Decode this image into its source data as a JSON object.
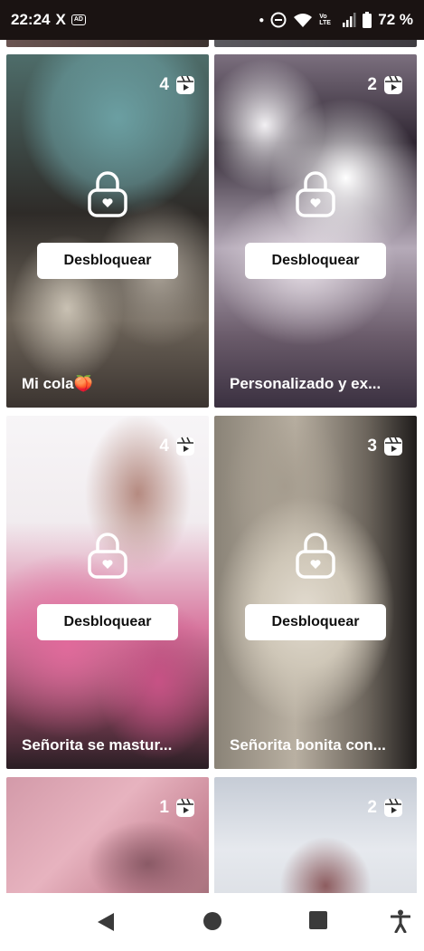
{
  "status_bar": {
    "time": "22:24",
    "x_icon": "X",
    "ad_icon": "AD",
    "network_label": "Vo LTE",
    "battery_percent": "72 %"
  },
  "cards": [
    {
      "count": "4",
      "unlock_label": "Desbloquear",
      "caption": "Mi cola",
      "caption_emoji": "🍑",
      "icon": "reels-icon",
      "palette": [
        "#5a8a8e",
        "#3a3530",
        "#b7b1a6"
      ]
    },
    {
      "count": "2",
      "unlock_label": "Desbloquear",
      "caption": "Personalizado y ex...",
      "caption_emoji": "",
      "icon": "reels-icon",
      "palette": [
        "#ffffff",
        "#3a2f3d",
        "#cfc6d1"
      ]
    },
    {
      "count": "4",
      "unlock_label": "Desbloquear",
      "caption": "Señorita se mastur...",
      "caption_emoji": "",
      "icon": "reels-icon",
      "palette": [
        "#f4f1f3",
        "#d65a8f",
        "#8a5a4e"
      ]
    },
    {
      "count": "3",
      "unlock_label": "Desbloquear",
      "caption": "Señorita bonita con...",
      "caption_emoji": "",
      "icon": "reels-icon",
      "palette": [
        "#9b9488",
        "#d9d2c6",
        "#3a3532"
      ]
    },
    {
      "count": "1",
      "unlock_label": "",
      "caption": "",
      "caption_emoji": "",
      "icon": "reels-icon",
      "palette": [
        "#cf8e9e",
        "#e3a9b6",
        "#7a4f5a"
      ]
    },
    {
      "count": "2",
      "unlock_label": "",
      "caption": "",
      "caption_emoji": "",
      "icon": "reels-icon",
      "palette": [
        "#c9d0db",
        "#e8ebf0",
        "#8d5c5f"
      ]
    }
  ],
  "nav": {
    "back": "back-icon",
    "home": "home-icon",
    "recents": "recents-icon",
    "accessibility": "accessibility-icon"
  }
}
